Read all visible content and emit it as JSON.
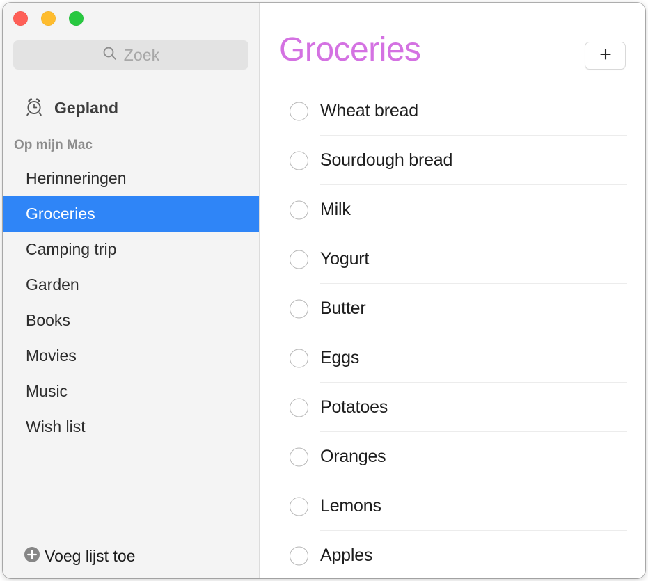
{
  "window": {
    "traffic_lights": [
      {
        "name": "close",
        "color": "#fe5f57"
      },
      {
        "name": "minimize",
        "color": "#febc2e"
      },
      {
        "name": "zoom",
        "color": "#28c840"
      }
    ]
  },
  "sidebar": {
    "search": {
      "placeholder": "Zoek",
      "value": "",
      "icon": "search-icon"
    },
    "scheduled": {
      "label": "Gepland",
      "icon": "alarm-clock-icon"
    },
    "section_header": "Op mijn Mac",
    "items": [
      {
        "label": "Herinneringen",
        "selected": false
      },
      {
        "label": "Groceries",
        "selected": true
      },
      {
        "label": "Camping trip",
        "selected": false
      },
      {
        "label": "Garden",
        "selected": false
      },
      {
        "label": "Books",
        "selected": false
      },
      {
        "label": "Movies",
        "selected": false
      },
      {
        "label": "Music",
        "selected": false
      },
      {
        "label": "Wish list",
        "selected": false
      }
    ],
    "add_list": {
      "label": "Voeg lijst toe",
      "icon": "plus-circle-icon"
    },
    "selection_color": "#2f85f7",
    "background_color": "#f4f4f4"
  },
  "main": {
    "title": "Groceries",
    "title_color": "#d472e2",
    "add_button": {
      "icon": "plus-icon",
      "label": "+"
    },
    "tasks": [
      {
        "label": "Wheat bread",
        "completed": false
      },
      {
        "label": "Sourdough bread",
        "completed": false
      },
      {
        "label": "Milk",
        "completed": false
      },
      {
        "label": "Yogurt",
        "completed": false
      },
      {
        "label": "Butter",
        "completed": false
      },
      {
        "label": "Eggs",
        "completed": false
      },
      {
        "label": "Potatoes",
        "completed": false
      },
      {
        "label": "Oranges",
        "completed": false
      },
      {
        "label": "Lemons",
        "completed": false
      },
      {
        "label": "Apples",
        "completed": false
      }
    ]
  }
}
